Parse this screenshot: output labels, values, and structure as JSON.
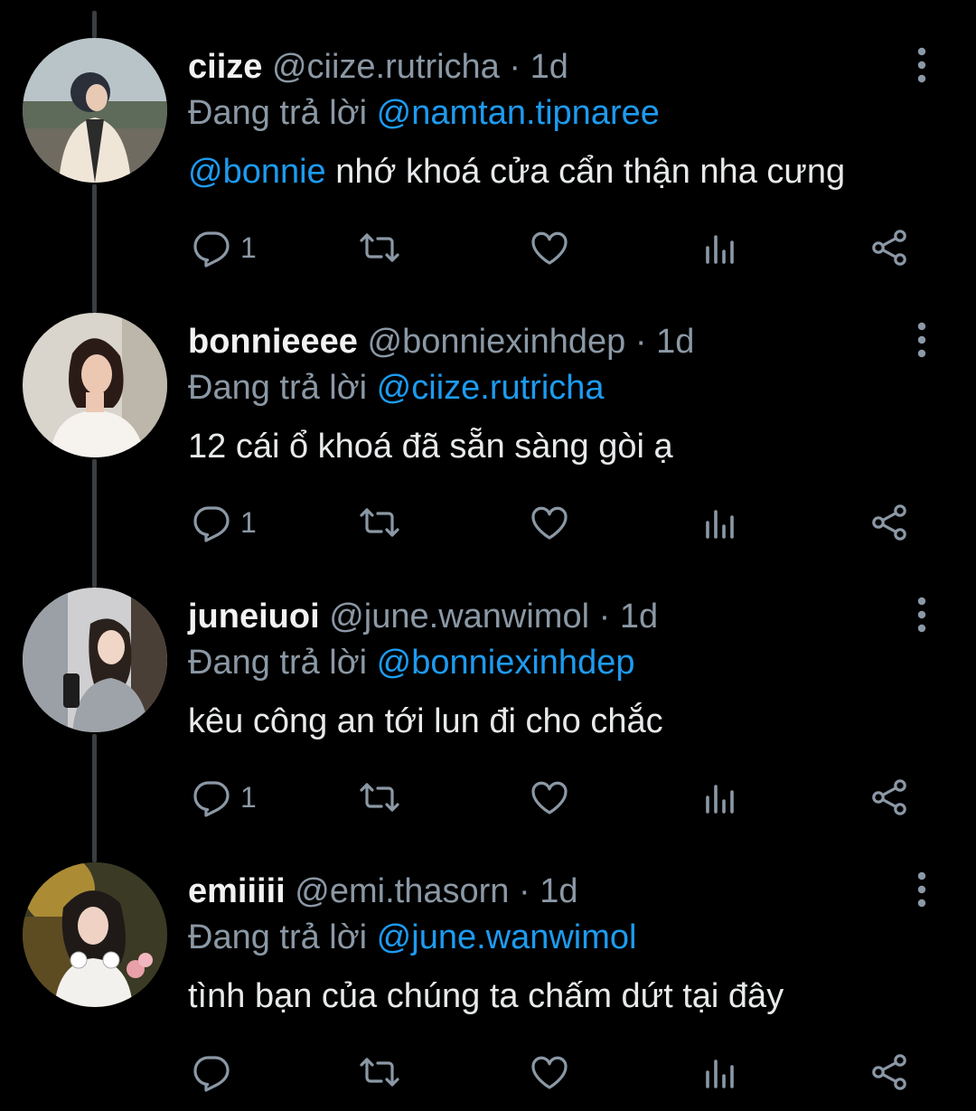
{
  "reply_prefix": "Đang trả lời",
  "colors": {
    "background": "#000000",
    "mention": "#1d9bf0",
    "muted": "#8b98a5",
    "text": "#e7e9ea"
  },
  "icons": {
    "reply": "comment-icon",
    "retweet": "retweet-icon",
    "like": "heart-icon",
    "views": "views-icon",
    "share": "share-icon",
    "more": "more-vertical-icon"
  },
  "posts": [
    {
      "name": "ciize",
      "handle": "@ciize.rutricha",
      "sep": "·",
      "time": "1d",
      "reply_to": "@namtan.tipnaree",
      "mention": "@bonnie",
      "text": " nhớ khoá cửa cẩn thận nha cưng",
      "reply_count": "1"
    },
    {
      "name": "bonnieeee",
      "handle": "@bonniexinhdep",
      "sep": "·",
      "time": "1d",
      "reply_to": "@ciize.rutricha",
      "mention": "",
      "text": "12 cái ổ khoá đã sẵn sàng gòi ạ",
      "reply_count": "1"
    },
    {
      "name": "juneiuoi",
      "handle": "@june.wanwimol",
      "sep": "·",
      "time": "1d",
      "reply_to": "@bonniexinhdep",
      "mention": "",
      "text": "kêu công an tới lun đi cho chắc",
      "reply_count": "1"
    },
    {
      "name": "emiiiii",
      "handle": "@emi.thasorn",
      "sep": "·",
      "time": "1d",
      "reply_to": "@june.wanwimol",
      "mention": "",
      "text": "tình bạn của chúng ta chấm dứt tại đây",
      "reply_count": ""
    }
  ]
}
